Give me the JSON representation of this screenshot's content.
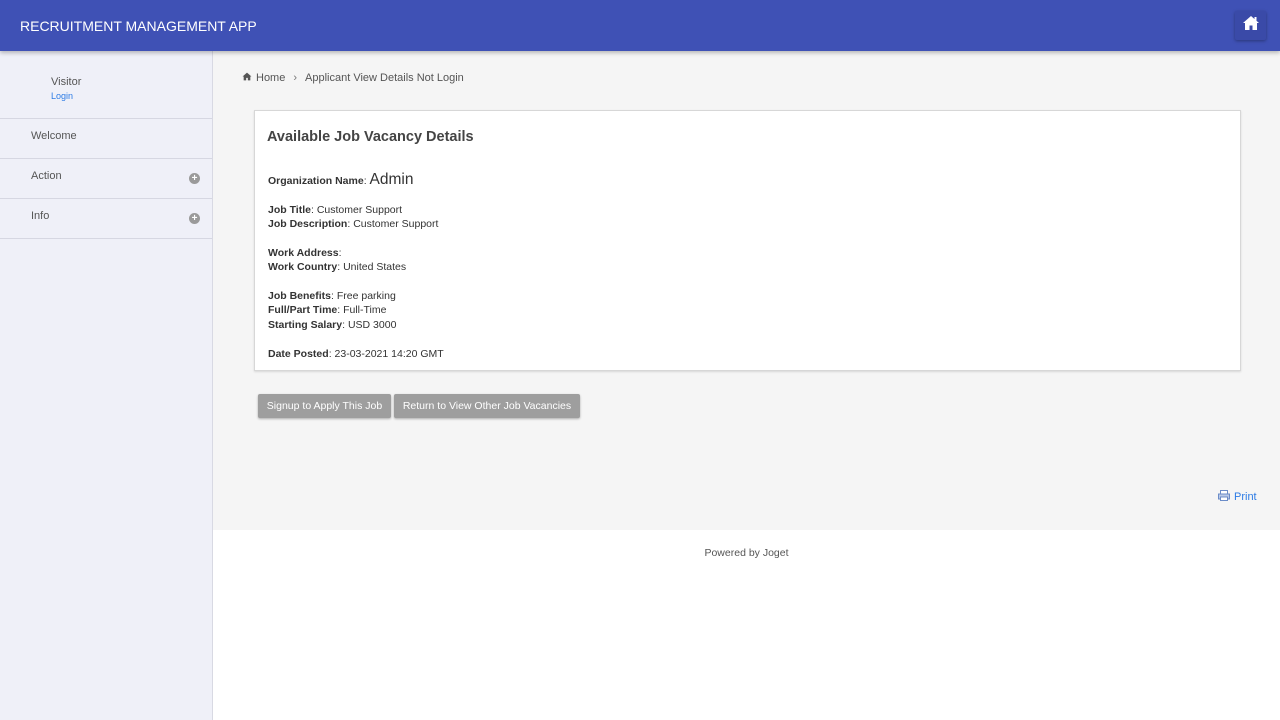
{
  "header": {
    "app_title": "RECRUITMENT MANAGEMENT APP",
    "home_icon": "home-icon"
  },
  "sidebar": {
    "user": {
      "name": "Visitor",
      "login_label": "Login"
    },
    "items": [
      {
        "label": "Welcome",
        "expandable": false
      },
      {
        "label": "Action",
        "expandable": true
      },
      {
        "label": "Info",
        "expandable": true
      }
    ]
  },
  "breadcrumb": {
    "home_label": "Home",
    "separator": "›",
    "current": "Applicant View Details Not Login"
  },
  "details": {
    "title": "Available Job Vacancy Details",
    "org_label": "Organization Name",
    "org_value": "Admin",
    "job_title_label": "Job Title",
    "job_title_value": "Customer Support",
    "job_desc_label": "Job Description",
    "job_desc_value": "Customer Support",
    "work_address_label": "Work Address",
    "work_address_value": "",
    "work_country_label": "Work Country",
    "work_country_value": "United States",
    "benefits_label": "Job Benefits",
    "benefits_value": "Free parking",
    "time_label": "Full/Part Time",
    "time_value": "Full-Time",
    "salary_label": "Starting Salary",
    "salary_value": "USD 3000",
    "date_label": "Date Posted",
    "date_value": "23-03-2021 14:20 GMT"
  },
  "actions": {
    "signup_label": "Signup to Apply This Job",
    "return_label": "Return to View Other Job Vacancies"
  },
  "print_label": "Print",
  "footer": {
    "powered_by": "Powered by Joget"
  },
  "colors": {
    "header_bg": "#3f51b5",
    "sidebar_bg": "#eff0f8",
    "link": "#2c7be5",
    "button_bg": "#9e9e9e"
  }
}
